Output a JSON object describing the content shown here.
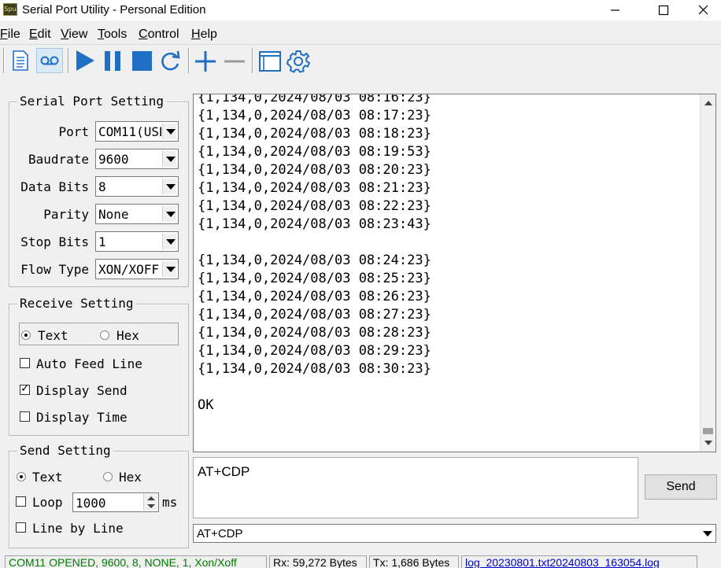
{
  "window": {
    "title": "Serial Port Utility - Personal Edition",
    "app_icon_text": "Spu"
  },
  "menu": [
    {
      "key": "F",
      "rest": "ile"
    },
    {
      "key": "E",
      "rest": "dit"
    },
    {
      "key": "V",
      "rest": "iew"
    },
    {
      "key": "T",
      "rest": "ools"
    },
    {
      "key": "C",
      "rest": "ontrol"
    },
    {
      "key": "H",
      "rest": "elp"
    }
  ],
  "toolbar": {
    "icons": [
      "new-document-icon",
      "record-icon",
      "play-icon",
      "pause-icon",
      "stop-icon",
      "refresh-icon",
      "add-icon",
      "remove-icon",
      "window-icon",
      "settings-gear-icon"
    ],
    "accent_color": "#1f6fc5"
  },
  "serial_port_setting": {
    "title": "Serial Port Setting",
    "fields": [
      {
        "label": "Port",
        "value": "COM11(USB"
      },
      {
        "label": "Baudrate",
        "value": "9600"
      },
      {
        "label": "Data Bits",
        "value": "8"
      },
      {
        "label": "Parity",
        "value": "None"
      },
      {
        "label": "Stop Bits",
        "value": "1"
      },
      {
        "label": "Flow Type",
        "value": "XON/XOFF"
      }
    ]
  },
  "receive_setting": {
    "title": "Receive Setting",
    "text_label": "Text",
    "hex_label": "Hex",
    "mode": "Text",
    "auto_feed_line": "Auto Feed Line",
    "auto_feed_line_checked": false,
    "display_send": "Display Send",
    "display_send_checked": true,
    "display_time": "Display Time",
    "display_time_checked": false
  },
  "send_setting": {
    "title": "Send Setting",
    "text_label": "Text",
    "hex_label": "Hex",
    "mode": "Text",
    "loop_label": "Loop",
    "loop_checked": false,
    "loop_interval": "1000",
    "loop_unit": "ms",
    "line_by_line": "Line by Line",
    "line_by_line_checked": false
  },
  "receive_area": {
    "lines": [
      "{1,134,0,2024/08/03 08:16:23}",
      "{1,134,0,2024/08/03 08:17:23}",
      "{1,134,0,2024/08/03 08:18:23}",
      "{1,134,0,2024/08/03 08:19:53}",
      "{1,134,0,2024/08/03 08:20:23}",
      "{1,134,0,2024/08/03 08:21:23}",
      "{1,134,0,2024/08/03 08:22:23}",
      "{1,134,0,2024/08/03 08:23:43}",
      "",
      "{1,134,0,2024/08/03 08:24:23}",
      "{1,134,0,2024/08/03 08:25:23}",
      "{1,134,0,2024/08/03 08:26:23}",
      "{1,134,0,2024/08/03 08:27:23}",
      "{1,134,0,2024/08/03 08:28:23}",
      "{1,134,0,2024/08/03 08:29:23}",
      "{1,134,0,2024/08/03 08:30:23}",
      "",
      "OK"
    ]
  },
  "send_area": {
    "text": "AT+CDP",
    "send_button": "Send",
    "history_value": "AT+CDP"
  },
  "status": {
    "connection": "COM11 OPENED, 9600, 8, NONE, 1, Xon/Xoff",
    "connection_color": "#007a00",
    "rx": "Rx: 59,272 Bytes",
    "tx": "Tx: 1,686 Bytes",
    "log_file": "log_20230801.txt20240803_163054.log",
    "log_color": "#0000cc"
  }
}
